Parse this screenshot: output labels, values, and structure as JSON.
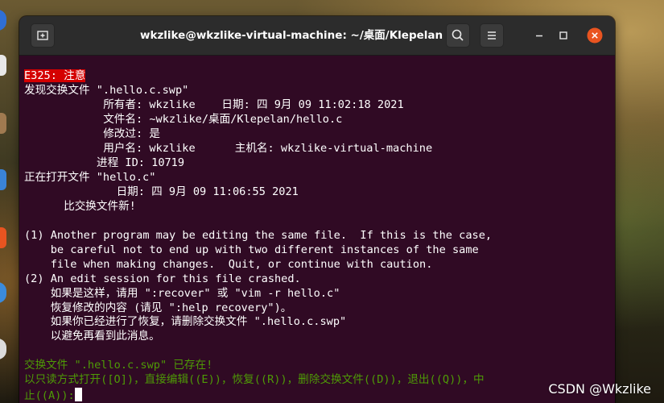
{
  "window": {
    "title": "wkzlike@wkzlike-virtual-machine: ~/桌面/Klepelan",
    "buttons": {
      "new_tab_icon": "new-tab-icon",
      "search_icon": "search-icon",
      "menu_icon": "hamburger-menu-icon",
      "minimize_icon": "minimize-icon",
      "maximize_icon": "maximize-icon",
      "close_icon": "close-icon"
    }
  },
  "terminal": {
    "error_code": "E325: 注意",
    "lines": [
      "发现交换文件 \".hello.c.swp\"",
      "            所有者: wkzlike    日期: 四 9月 09 11:02:18 2021",
      "            文件名: ~wkzlike/桌面/Klepelan/hello.c",
      "            修改过: 是",
      "            用户名: wkzlike      主机名: wkzlike-virtual-machine",
      "           进程 ID: 10719",
      "正在打开文件 \"hello.c\"",
      "              日期: 四 9月 09 11:06:55 2021",
      "      比交换文件新!",
      "",
      "(1) Another program may be editing the same file.  If this is the case,",
      "    be careful not to end up with two different instances of the same",
      "    file when making changes.  Quit, or continue with caution.",
      "(2) An edit session for this file crashed.",
      "    如果是这样，请用 \":recover\" 或 \"vim -r hello.c\"",
      "    恢复修改的内容 (请见 \":help recovery\")。",
      "    如果你已经进行了恢复，请删除交换文件 \".hello.c.swp\"",
      "    以避免再看到此消息。",
      ""
    ],
    "prompt_line1": "交换文件 \".hello.c.swp\" 已存在!",
    "prompt_line2": "以只读方式打开([O])，直接编辑((E))，恢复((R))，删除交换文件((D))，退出((Q))，中",
    "prompt_line3": "止((A)):"
  },
  "watermark": "CSDN @Wkzlike",
  "colors": {
    "terminal_bg": "#300a24",
    "titlebar_bg": "#2c2c2c",
    "error_bg": "#d40000",
    "prompt_green": "#4e9a06",
    "close_orange": "#e95420"
  }
}
